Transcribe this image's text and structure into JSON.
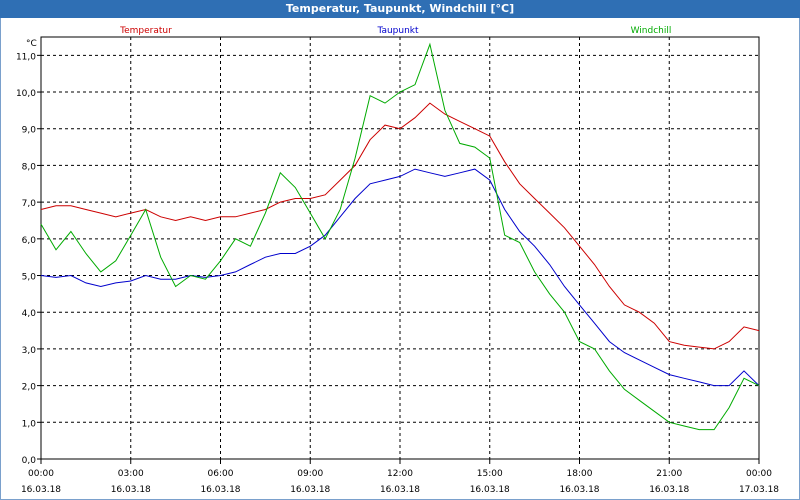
{
  "window": {
    "title": "Temperatur, Taupunkt, Windchill [°C]"
  },
  "colors": {
    "titlebar": "#2f6fb4",
    "grid": "#000000",
    "temperature": "#cc0000",
    "dewpoint": "#0000cc",
    "windchill": "#00aa00"
  },
  "chart_data": {
    "type": "line",
    "title": "Temperatur, Taupunkt, Windchill [°C]",
    "ylabel": "°C",
    "ylim": [
      0,
      11.5
    ],
    "grid": true,
    "legend_placement": "top",
    "y_ticks": [
      "0,0",
      "1,0",
      "2,0",
      "3,0",
      "4,0",
      "5,0",
      "6,0",
      "7,0",
      "8,0",
      "9,0",
      "10,0",
      "11,0"
    ],
    "x_ticks": [
      {
        "time": "00:00",
        "date": "16.03.18"
      },
      {
        "time": "03:00",
        "date": "16.03.18"
      },
      {
        "time": "06:00",
        "date": "16.03.18"
      },
      {
        "time": "09:00",
        "date": "16.03.18"
      },
      {
        "time": "12:00",
        "date": "16.03.18"
      },
      {
        "time": "15:00",
        "date": "16.03.18"
      },
      {
        "time": "18:00",
        "date": "16.03.18"
      },
      {
        "time": "21:00",
        "date": "16.03.18"
      },
      {
        "time": "00:00",
        "date": "17.03.18"
      }
    ],
    "x": [
      0,
      0.5,
      1,
      1.5,
      2,
      2.5,
      3,
      3.5,
      4,
      4.5,
      5,
      5.5,
      6,
      6.5,
      7,
      7.5,
      8,
      8.5,
      9,
      9.5,
      10,
      10.5,
      11,
      11.5,
      12,
      12.5,
      13,
      13.5,
      14,
      14.5,
      15,
      15.5,
      16,
      16.5,
      17,
      17.5,
      18,
      18.5,
      19,
      19.5,
      20,
      20.5,
      21,
      21.5,
      22,
      22.5,
      23,
      23.5,
      24
    ],
    "series": [
      {
        "name": "Temperatur",
        "color": "#cc0000",
        "values": [
          6.8,
          6.9,
          6.9,
          6.8,
          6.7,
          6.6,
          6.7,
          6.8,
          6.6,
          6.5,
          6.6,
          6.5,
          6.6,
          6.6,
          6.7,
          6.8,
          7.0,
          7.1,
          7.1,
          7.2,
          7.6,
          8.0,
          8.7,
          9.1,
          9.0,
          9.3,
          9.7,
          9.4,
          9.2,
          9.0,
          8.8,
          8.1,
          7.5,
          7.1,
          6.7,
          6.3,
          5.8,
          5.3,
          4.7,
          4.2,
          4.0,
          3.7,
          3.2,
          3.1,
          3.05,
          3.0,
          3.2,
          3.6,
          3.5
        ]
      },
      {
        "name": "Taupunkt",
        "color": "#0000cc",
        "values": [
          5.0,
          4.95,
          5.0,
          4.8,
          4.7,
          4.8,
          4.85,
          5.0,
          4.9,
          4.9,
          5.0,
          4.95,
          5.0,
          5.1,
          5.3,
          5.5,
          5.6,
          5.6,
          5.8,
          6.1,
          6.6,
          7.1,
          7.5,
          7.6,
          7.7,
          7.9,
          7.8,
          7.7,
          7.8,
          7.9,
          7.6,
          6.8,
          6.2,
          5.8,
          5.3,
          4.7,
          4.2,
          3.7,
          3.2,
          2.9,
          2.7,
          2.5,
          2.3,
          2.2,
          2.1,
          2.0,
          2.0,
          2.4,
          2.0
        ]
      },
      {
        "name": "Windchill",
        "color": "#00aa00",
        "values": [
          6.4,
          5.7,
          6.2,
          5.6,
          5.1,
          5.4,
          6.1,
          6.8,
          5.5,
          4.7,
          5.0,
          4.9,
          5.4,
          6.0,
          5.8,
          6.7,
          7.8,
          7.4,
          6.7,
          6.0,
          6.8,
          8.2,
          9.9,
          9.7,
          10.0,
          10.2,
          11.3,
          9.5,
          8.6,
          8.5,
          8.2,
          6.1,
          5.9,
          5.1,
          4.5,
          4.0,
          3.2,
          3.0,
          2.4,
          1.9,
          1.6,
          1.3,
          1.0,
          0.9,
          0.8,
          0.8,
          1.4,
          2.2,
          2.0
        ]
      }
    ]
  }
}
